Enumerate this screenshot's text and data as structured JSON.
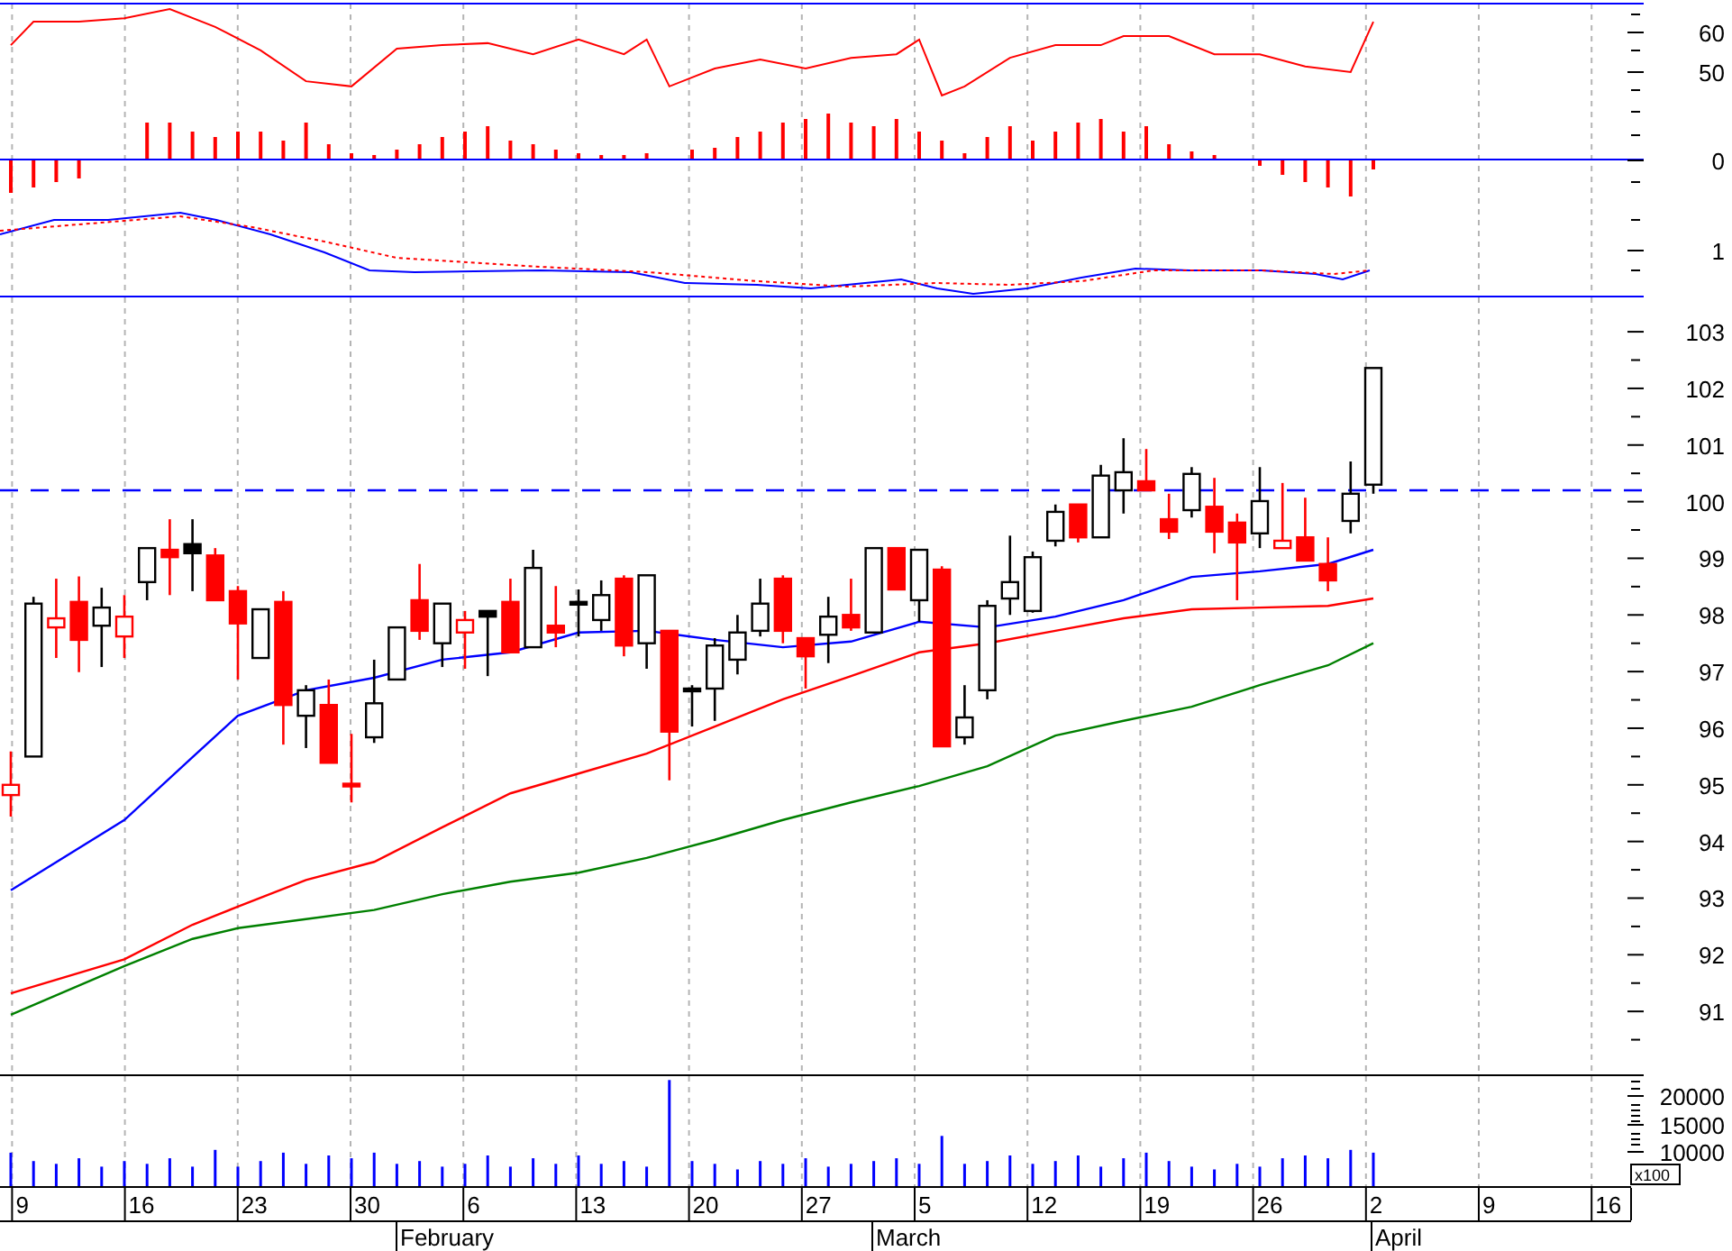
{
  "oscillator_panel": {
    "tick_labels": [
      "60",
      "50"
    ]
  },
  "macd_panel": {
    "tick_labels": [
      "0",
      "1"
    ]
  },
  "price_panel": {
    "tick_labels": [
      "103",
      "102",
      "101",
      "100",
      "99",
      "98",
      "97",
      "96",
      "95",
      "94",
      "93",
      "92",
      "91"
    ]
  },
  "volume_panel": {
    "tick_labels": [
      "20000",
      "15000",
      "10000"
    ],
    "scale_note": "x100"
  },
  "date_axis": {
    "days": [
      "9",
      "16",
      "23",
      "30",
      "6",
      "13",
      "20",
      "27",
      "5",
      "12",
      "19",
      "26",
      "2",
      "9",
      "16"
    ],
    "months": [
      "February",
      "March",
      "April"
    ]
  }
}
